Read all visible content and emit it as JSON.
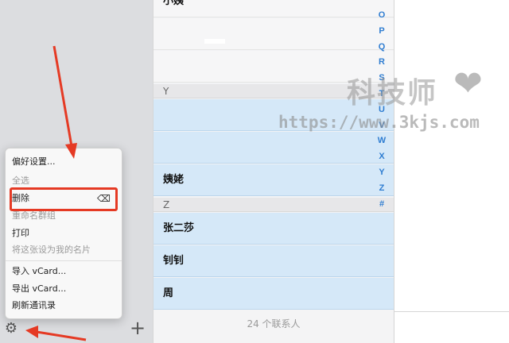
{
  "sidebar": {
    "bottom": {
      "gear_icon": "gear-icon",
      "plus_label": "+"
    }
  },
  "menu": {
    "items": [
      {
        "label": "偏好设置...",
        "disabled": false
      },
      {
        "label": "全选",
        "disabled": true
      },
      {
        "label": "删除",
        "disabled": false
      },
      {
        "label": "重命名群组",
        "disabled": true
      },
      {
        "label": "打印",
        "disabled": false
      },
      {
        "label": "将这张设为我的名片",
        "disabled": true
      },
      {
        "label": "导入 vCard...",
        "disabled": false
      },
      {
        "label": "导出 vCard...",
        "disabled": false
      },
      {
        "label": "刷新通讯录",
        "disabled": false
      }
    ],
    "delete_key_symbol": "⌫",
    "highlight_color": "#e53a24"
  },
  "contacts": {
    "top_row": "小姨",
    "sections": [
      {
        "letter": "Y",
        "rows": [
          "",
          "",
          "姨姥"
        ]
      },
      {
        "letter": "Z",
        "rows": [
          "张二莎",
          "钊钊",
          "周"
        ]
      }
    ],
    "footer": "24 个联系人"
  },
  "index_letters": [
    "O",
    "P",
    "Q",
    "R",
    "S",
    "T",
    "U",
    "V",
    "W",
    "X",
    "Y",
    "Z",
    "#"
  ],
  "watermark": {
    "title": "科技师",
    "url": "https://www.3kjs.com"
  },
  "colors": {
    "selected_row": "#d5e8f8",
    "index_letter": "#2f7dd1",
    "arrow": "#e53a24"
  }
}
